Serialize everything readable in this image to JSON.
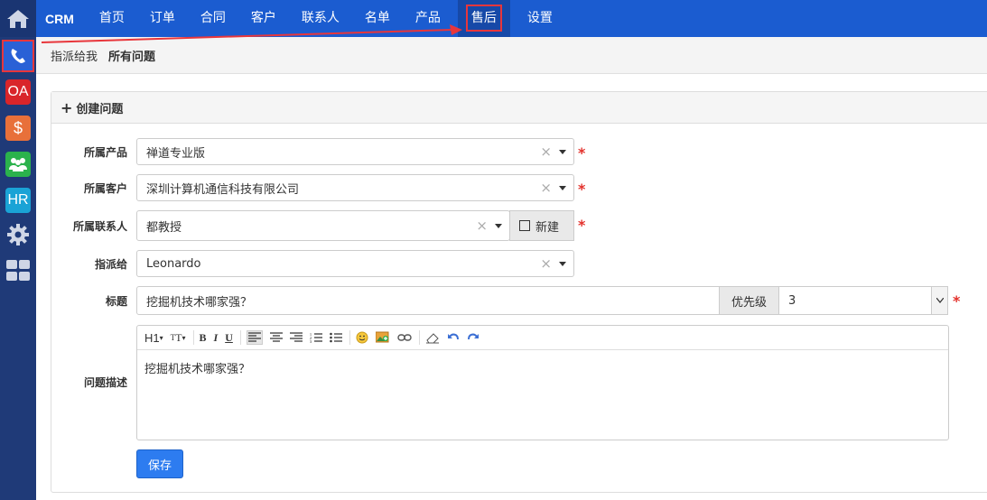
{
  "rail": {
    "items": [
      {
        "name": "home-icon"
      },
      {
        "name": "phone-icon",
        "color": "#2a61d6"
      },
      {
        "name": "oa-icon",
        "label": "OA",
        "color": "#d9252a"
      },
      {
        "name": "dollar-icon",
        "label": "$",
        "color": "#e8703a"
      },
      {
        "name": "users-icon",
        "color": "#2bb24c"
      },
      {
        "name": "hr-icon",
        "label": "HR",
        "color": "#1aa3d6"
      },
      {
        "name": "gear-icon"
      },
      {
        "name": "grid-icon"
      }
    ]
  },
  "topnav": {
    "brand": "CRM",
    "items": [
      "首页",
      "订单",
      "合同",
      "客户",
      "联系人",
      "名单",
      "产品",
      "售后",
      "设置"
    ],
    "active": "售后"
  },
  "subnav": {
    "items": [
      "指派给我",
      "所有问题"
    ]
  },
  "panel": {
    "title": "创建问题"
  },
  "form": {
    "product": {
      "label": "所属产品",
      "value": "禅道专业版"
    },
    "customer": {
      "label": "所属客户",
      "value": "深圳计算机通信科技有限公司"
    },
    "contact": {
      "label": "所属联系人",
      "value": "都教授",
      "new_label": "新建"
    },
    "assignee": {
      "label": "指派给",
      "value": "Leonardo"
    },
    "title": {
      "label": "标题",
      "value": "挖掘机技术哪家强？"
    },
    "priority": {
      "label": "优先级",
      "value": "3"
    },
    "description": {
      "label": "问题描述",
      "value": "挖掘机技术哪家强？"
    },
    "required_mark": "*",
    "save_label": "保存"
  },
  "editor": {
    "toolbar": [
      "H1",
      "TT",
      "B",
      "I",
      "U",
      "align-left",
      "align-center",
      "align-right",
      "ordered-list",
      "unordered-list",
      "emoji",
      "image",
      "link",
      "eraser",
      "undo",
      "redo"
    ]
  },
  "colors": {
    "topnav": "#1b5cd0",
    "rail": "#1f3a78",
    "accent": "#2d7cf0",
    "annotation_red": "#e8363b"
  }
}
